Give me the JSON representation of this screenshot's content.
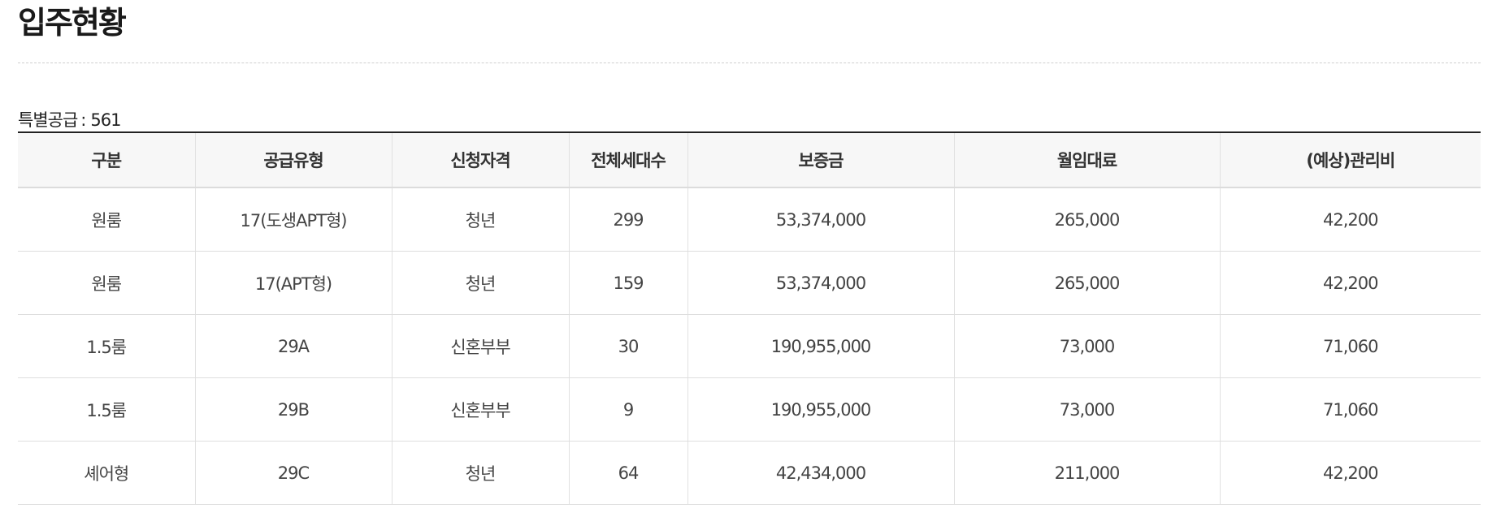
{
  "page": {
    "title": "입주현황"
  },
  "section": {
    "label": "특별공급",
    "separator": ":",
    "count": "561"
  },
  "table": {
    "headers": [
      "구분",
      "공급유형",
      "신청자격",
      "전체세대수",
      "보증금",
      "월임대료",
      "(예상)관리비"
    ],
    "rows": [
      [
        "원룸",
        "17(도생APT형)",
        "청년",
        "299",
        "53,374,000",
        "265,000",
        "42,200"
      ],
      [
        "원룸",
        "17(APT형)",
        "청년",
        "159",
        "53,374,000",
        "265,000",
        "42,200"
      ],
      [
        "1.5룸",
        "29A",
        "신혼부부",
        "30",
        "190,955,000",
        "73,000",
        "71,060"
      ],
      [
        "1.5룸",
        "29B",
        "신혼부부",
        "9",
        "190,955,000",
        "73,000",
        "71,060"
      ],
      [
        "셰어형",
        "29C",
        "청년",
        "64",
        "42,434,000",
        "211,000",
        "42,200"
      ]
    ]
  }
}
